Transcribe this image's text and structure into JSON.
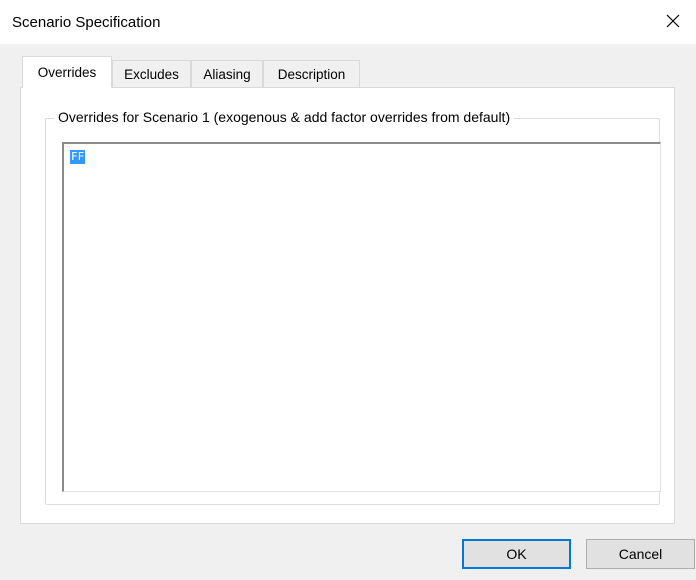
{
  "window": {
    "title": "Scenario Specification",
    "close_icon": "close-icon"
  },
  "tabs": [
    {
      "label": "Overrides",
      "active": true
    },
    {
      "label": "Excludes",
      "active": false
    },
    {
      "label": "Aliasing",
      "active": false
    },
    {
      "label": "Description",
      "active": false
    }
  ],
  "overrides": {
    "group_label": "Overrides for Scenario 1 (exogenous & add factor overrides from default)",
    "text_value": "FF"
  },
  "buttons": {
    "ok_label": "OK",
    "cancel_label": "Cancel"
  },
  "colors": {
    "accent": "#0078d7",
    "selection": "#3399ff"
  }
}
